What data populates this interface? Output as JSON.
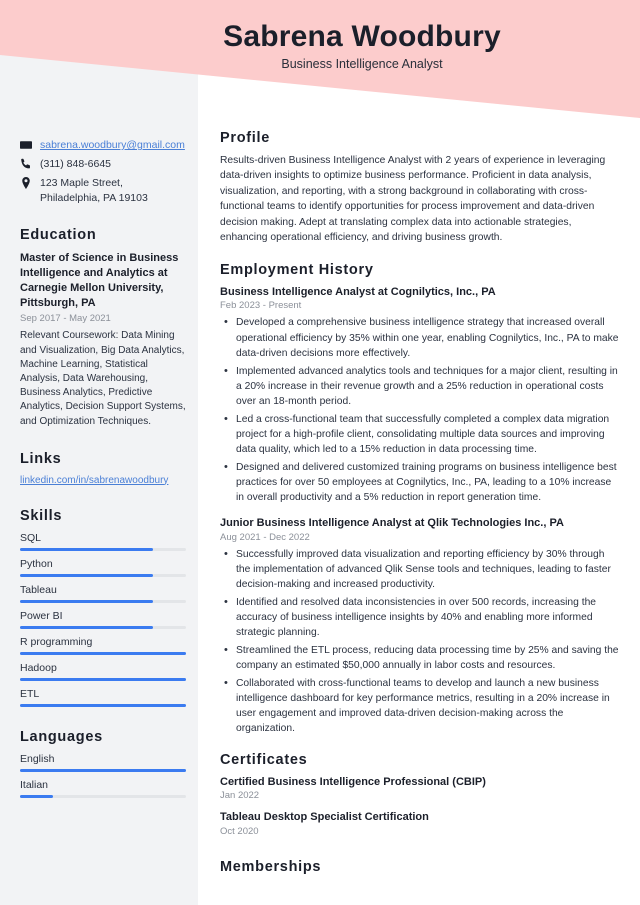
{
  "header": {
    "name": "Sabrena Woodbury",
    "job_title": "Business Intelligence Analyst",
    "banner_color": "#fccccc"
  },
  "theme": {
    "sidebar_bg": "#f2f3f5",
    "accent": "#3b7bf0",
    "link": "#4a7fd6",
    "text": "#2b3240",
    "muted": "#8b9099"
  },
  "sidebar": {
    "contact": [
      {
        "icon": "envelope-icon",
        "text": "sabrena.woodbury@gmail.com",
        "is_link": true
      },
      {
        "icon": "phone-icon",
        "text": "(311) 848-6645",
        "is_link": false
      },
      {
        "icon": "location-pin-icon",
        "text": "123 Maple Street,\nPhiladelphia, PA 19103",
        "is_link": false
      }
    ],
    "education": {
      "heading": "Education",
      "degree": "Master of Science in Business Intelligence and Analytics at Carnegie Mellon University, Pittsburgh, PA",
      "date": "Sep 2017 - May 2021",
      "description": "Relevant Coursework: Data Mining and Visualization, Big Data Analytics, Machine Learning, Statistical Analysis, Data Warehousing, Business Analytics, Predictive Analytics, Decision Support Systems, and Optimization Techniques."
    },
    "links": {
      "heading": "Links",
      "items": [
        {
          "label": "linkedin.com/in/sabrenawoodbury"
        }
      ]
    },
    "skills": {
      "heading": "Skills",
      "items": [
        {
          "label": "SQL",
          "level": 80
        },
        {
          "label": "Python",
          "level": 80
        },
        {
          "label": "Tableau",
          "level": 80
        },
        {
          "label": "Power BI",
          "level": 80
        },
        {
          "label": "R programming",
          "level": 100
        },
        {
          "label": "Hadoop",
          "level": 100
        },
        {
          "label": "ETL",
          "level": 100
        }
      ]
    },
    "languages": {
      "heading": "Languages",
      "items": [
        {
          "label": "English",
          "level": 100
        },
        {
          "label": "Italian",
          "level": 20
        }
      ]
    }
  },
  "main": {
    "profile": {
      "heading": "Profile",
      "text": "Results-driven Business Intelligence Analyst with 2 years of experience in leveraging data-driven insights to optimize business performance. Proficient in data analysis, visualization, and reporting, with a strong background in collaborating with cross-functional teams to identify opportunities for process improvement and data-driven decision making. Adept at translating complex data into actionable strategies, enhancing operational efficiency, and driving business growth."
    },
    "employment": {
      "heading": "Employment History",
      "jobs": [
        {
          "title": "Business Intelligence Analyst at Cognilytics, Inc., PA",
          "date": "Feb 2023 - Present",
          "bullets": [
            "Developed a comprehensive business intelligence strategy that increased overall operational efficiency by 35% within one year, enabling Cognilytics, Inc., PA to make data-driven decisions more effectively.",
            "Implemented advanced analytics tools and techniques for a major client, resulting in a 20% increase in their revenue growth and a 25% reduction in operational costs over an 18-month period.",
            "Led a cross-functional team that successfully completed a complex data migration project for a high-profile client, consolidating multiple data sources and improving data quality, which led to a 15% reduction in data processing time.",
            "Designed and delivered customized training programs on business intelligence best practices for over 50 employees at Cognilytics, Inc., PA, leading to a 10% increase in overall productivity and a 5% reduction in report generation time."
          ]
        },
        {
          "title": "Junior Business Intelligence Analyst at Qlik Technologies Inc., PA",
          "date": "Aug 2021 - Dec 2022",
          "bullets": [
            "Successfully improved data visualization and reporting efficiency by 30% through the implementation of advanced Qlik Sense tools and techniques, leading to faster decision-making and increased productivity.",
            "Identified and resolved data inconsistencies in over 500 records, increasing the accuracy of business intelligence insights by 40% and enabling more informed strategic planning.",
            "Streamlined the ETL process, reducing data processing time by 25% and saving the company an estimated $50,000 annually in labor costs and resources.",
            "Collaborated with cross-functional teams to develop and launch a new business intelligence dashboard for key performance metrics, resulting in a 20% increase in user engagement and improved data-driven decision-making across the organization."
          ]
        }
      ]
    },
    "certificates": {
      "heading": "Certificates",
      "items": [
        {
          "title": "Certified Business Intelligence Professional (CBIP)",
          "date": "Jan 2022"
        },
        {
          "title": "Tableau Desktop Specialist Certification",
          "date": "Oct 2020"
        }
      ]
    },
    "memberships": {
      "heading": "Memberships"
    }
  }
}
